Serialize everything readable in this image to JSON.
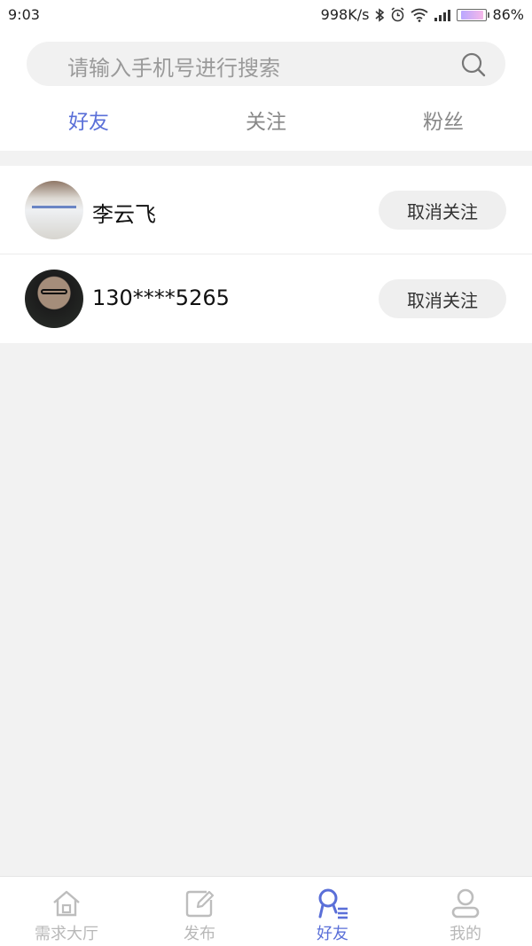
{
  "status_bar": {
    "time": "9:03",
    "network_speed": "998K/s",
    "battery_percent": "86%",
    "battery_level": 0.86,
    "icons": [
      "bluetooth-icon",
      "alarm-icon",
      "wifi-icon",
      "signal-icon",
      "battery-icon"
    ]
  },
  "search": {
    "placeholder": "请输入手机号进行搜索",
    "icon": "search-icon"
  },
  "tabs": [
    {
      "label": "好友",
      "active": true
    },
    {
      "label": "关注",
      "active": false
    },
    {
      "label": "粉丝",
      "active": false
    }
  ],
  "list": {
    "items": [
      {
        "name": "李云飞",
        "action_label": "取消关注"
      },
      {
        "name": "130****5265",
        "action_label": "取消关注"
      }
    ]
  },
  "bottom_nav": {
    "items": [
      {
        "label": "需求大厅",
        "icon": "home-icon",
        "active": false
      },
      {
        "label": "发布",
        "icon": "edit-icon",
        "active": false
      },
      {
        "label": "好友",
        "icon": "friends-icon",
        "active": true
      },
      {
        "label": "我的",
        "icon": "profile-icon",
        "active": false
      }
    ]
  },
  "colors": {
    "accent": "#5a6fd8",
    "background": "#f2f2f2",
    "inactive": "#b8b8b8"
  }
}
